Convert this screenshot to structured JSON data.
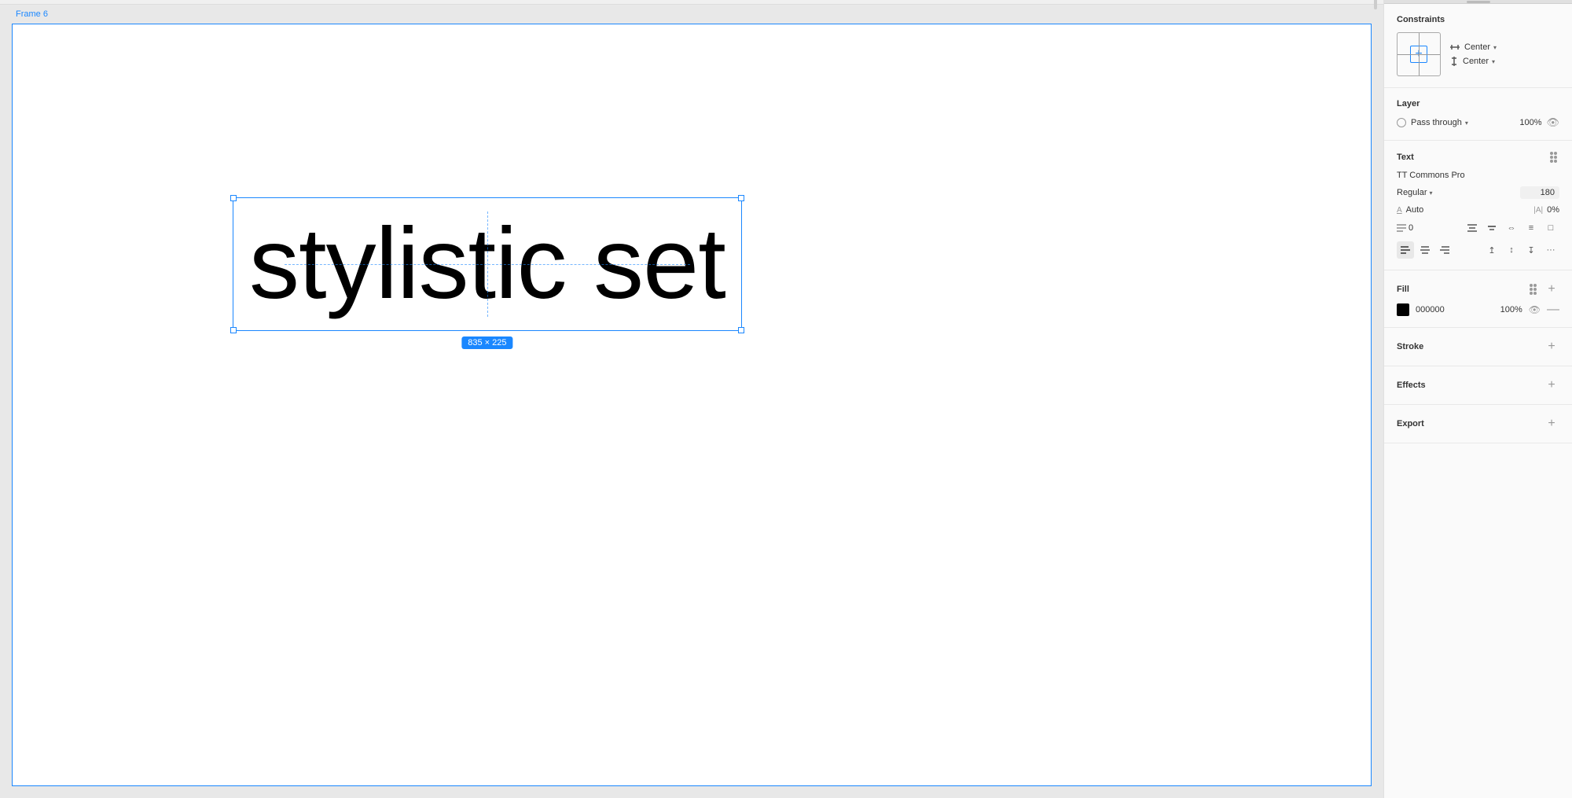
{
  "frame": {
    "label": "Frame 6"
  },
  "canvas": {
    "text": "stylistic set",
    "dimension": "835 × 225"
  },
  "panel": {
    "constraints": {
      "title": "Constraints",
      "horizontal_label": "Center",
      "vertical_label": "Center"
    },
    "layer": {
      "title": "Layer",
      "blend_mode": "Pass through",
      "opacity": "100%"
    },
    "text": {
      "title": "Text",
      "font_name": "TT Commons Pro",
      "font_weight": "Regular",
      "font_size": "180",
      "line_height_label": "A",
      "line_height_value": "Auto",
      "tracking_label": "|A|",
      "tracking_value": "0%",
      "paragraph_spacing": "0",
      "dots_btn": "···",
      "plus_btn": "+"
    },
    "fill": {
      "title": "Fill",
      "color": "000000",
      "opacity": "100%"
    },
    "stroke": {
      "title": "Stroke"
    },
    "effects": {
      "title": "Effects"
    },
    "export": {
      "title": "Export"
    }
  }
}
